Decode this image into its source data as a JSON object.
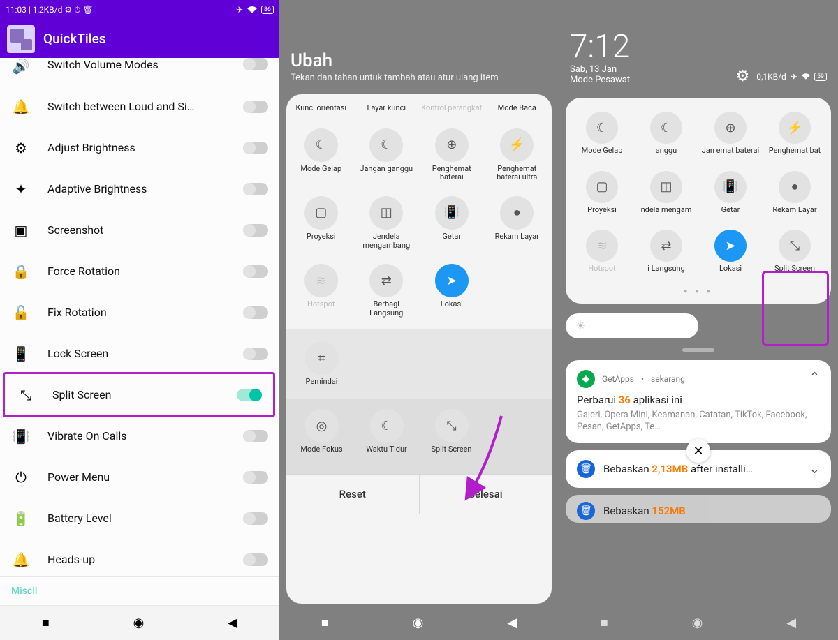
{
  "panel1": {
    "status": {
      "time": "11:03",
      "speed": "1,2KB/d",
      "battery": "86"
    },
    "app_title": "QuickTiles",
    "items": [
      {
        "label": "Switch Volume Modes",
        "icon": "volume",
        "on": false,
        "cut": true
      },
      {
        "label": "Switch between Loud and Si…",
        "icon": "ring",
        "on": false
      },
      {
        "label": "Adjust Brightness",
        "icon": "sun-gear",
        "on": false
      },
      {
        "label": "Adaptive Brightness",
        "icon": "sun-auto",
        "on": false
      },
      {
        "label": "Screenshot",
        "icon": "screenshot",
        "on": false
      },
      {
        "label": "Force Rotation",
        "icon": "rotate-lock",
        "on": false
      },
      {
        "label": "Fix Rotation",
        "icon": "rotate-fix",
        "on": false
      },
      {
        "label": "Lock Screen",
        "icon": "lock-phone",
        "on": false
      },
      {
        "label": "Split Screen",
        "icon": "split",
        "on": true,
        "hl": true
      },
      {
        "label": "Vibrate On Calls",
        "icon": "vibrate",
        "on": false
      },
      {
        "label": "Power Menu",
        "icon": "power",
        "on": false
      },
      {
        "label": "Battery Level",
        "icon": "battery",
        "on": false
      },
      {
        "label": "Heads-up",
        "icon": "bell",
        "on": false
      }
    ],
    "section_misc": "Miscll"
  },
  "panel2": {
    "title": "Ubah",
    "subtitle": "Tekan dan tahan untuk tambah atau atur ulang item",
    "row1_labels": [
      "Kunci orientasi",
      "Layar kunci",
      "Kontrol perangkat",
      "Mode Baca"
    ],
    "tiles": [
      {
        "label": "Mode Gelap",
        "icon": "moon-sun"
      },
      {
        "label": "Jangan ganggu",
        "icon": "moon"
      },
      {
        "label": "Penghemat baterai",
        "icon": "battery-plus"
      },
      {
        "label": "Penghemat baterai ultra",
        "icon": "bolt"
      },
      {
        "label": "Proyeksi",
        "icon": "cast"
      },
      {
        "label": "Jendela mengambang",
        "icon": "window"
      },
      {
        "label": "Getar",
        "icon": "vibrate"
      },
      {
        "label": "Rekam Layar",
        "icon": "record"
      },
      {
        "label": "Hotspot",
        "icon": "hotspot",
        "dim": true
      },
      {
        "label": "Berbagi Langsung",
        "icon": "share"
      },
      {
        "label": "Lokasi",
        "icon": "location",
        "blue": true
      }
    ],
    "scanner": {
      "label": "Pemindai",
      "icon": "scan"
    },
    "available": [
      {
        "label": "Mode Fokus",
        "icon": "focus"
      },
      {
        "label": "Waktu Tidur",
        "icon": "bedtime"
      },
      {
        "label": "Split Screen",
        "icon": "split"
      }
    ],
    "btn_reset": "Reset",
    "btn_done": "Selesai"
  },
  "panel3": {
    "clock": "7:12",
    "date": "Sab, 13 Jan",
    "mode": "Mode Pesawat",
    "speed": "0,1KB/d",
    "battery": "59",
    "tiles": [
      {
        "label": "Mode Gelap",
        "icon": "moon-sun"
      },
      {
        "label": "anggu",
        "icon": "moon"
      },
      {
        "label": "Jan  emat baterai",
        "icon": "battery-plus"
      },
      {
        "label": "Penghemat bat",
        "icon": "bolt"
      },
      {
        "label": "Proyeksi",
        "icon": "cast"
      },
      {
        "label": "ndela mengam",
        "icon": "window"
      },
      {
        "label": "Getar",
        "icon": "vibrate"
      },
      {
        "label": "Rekam Layar",
        "icon": "record"
      },
      {
        "label": "Hotspot",
        "icon": "hotspot",
        "dim": true
      },
      {
        "label": "i Langsung",
        "icon": "share"
      },
      {
        "label": "Lokasi",
        "icon": "location",
        "blue": true
      },
      {
        "label": "Split Screen",
        "icon": "split",
        "hl": true
      }
    ],
    "notif1": {
      "app": "GetApps",
      "when": "sekarang",
      "title_pre": "Perbarui ",
      "title_num": "36",
      "title_post": " aplikasi ini",
      "body": "Galeri, Opera Mini, Keamanan, Catatan, TikTok, Facebook, Pesan, GetApps, Te…"
    },
    "notif2": {
      "title_pre": "Bebaskan ",
      "title_num": "2,13MB",
      "title_post": " after installi…"
    },
    "notif3": {
      "title_pre": "Bebaskan ",
      "title_num": "152MB"
    }
  }
}
